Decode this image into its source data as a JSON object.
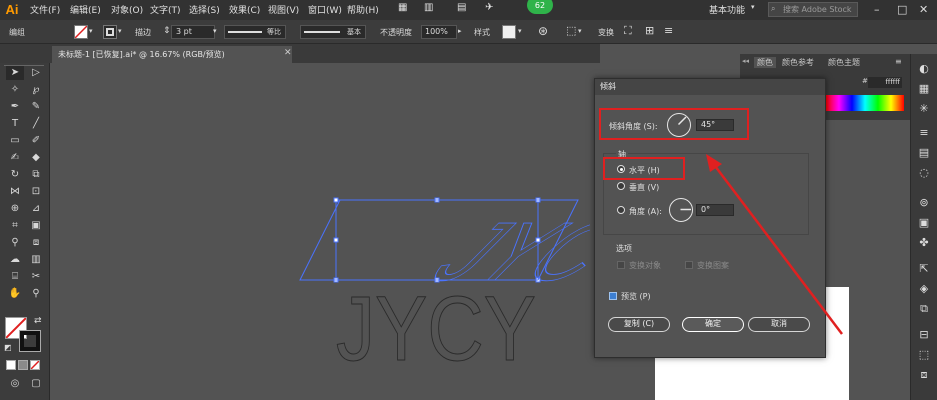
{
  "app": {
    "logo": "Ai",
    "menus": [
      "文件(F)",
      "编辑(E)",
      "对象(O)",
      "文字(T)",
      "选择(S)",
      "效果(C)",
      "视图(V)",
      "窗口(W)",
      "帮助(H)"
    ],
    "notification_count": "62",
    "workspace": "基本功能",
    "search_placeholder": "搜索 Adobe Stock"
  },
  "control_bar": {
    "mode_label": "编组",
    "stroke_label": "描边",
    "stroke_value": "3 pt",
    "stroke_profile": "等比",
    "brush_label": "基本",
    "opacity_label": "不透明度",
    "opacity_value": "100%",
    "style_label": "样式",
    "transform_label": "变换"
  },
  "document": {
    "tab_title": "未标题-1 [已恢复].ai* @ 16.67% (RGB/预览)"
  },
  "right_panel": {
    "tabs": [
      "颜色",
      "颜色参考",
      "颜色主题"
    ],
    "hex_value": "ffffff"
  },
  "dialog": {
    "title": "倾斜",
    "angle_label": "倾斜角度 (S):",
    "angle_value": "45°",
    "axis_label": "轴",
    "axis_horizontal": "水平 (H)",
    "axis_vertical": "垂直 (V)",
    "axis_angle_label": "角度 (A):",
    "axis_angle_value": "0°",
    "options_label": "选项",
    "option_transform_objects": "变换对象",
    "option_transform_patterns": "变换图案",
    "preview_label": "预览 (P)",
    "copy_button": "复制 (C)",
    "ok_button": "确定",
    "cancel_button": "取消"
  },
  "artwork": {
    "text": "JYCY"
  },
  "colors": {
    "accent": "#e02020",
    "selection": "#4a73ff",
    "brand": "#ff9a00"
  }
}
